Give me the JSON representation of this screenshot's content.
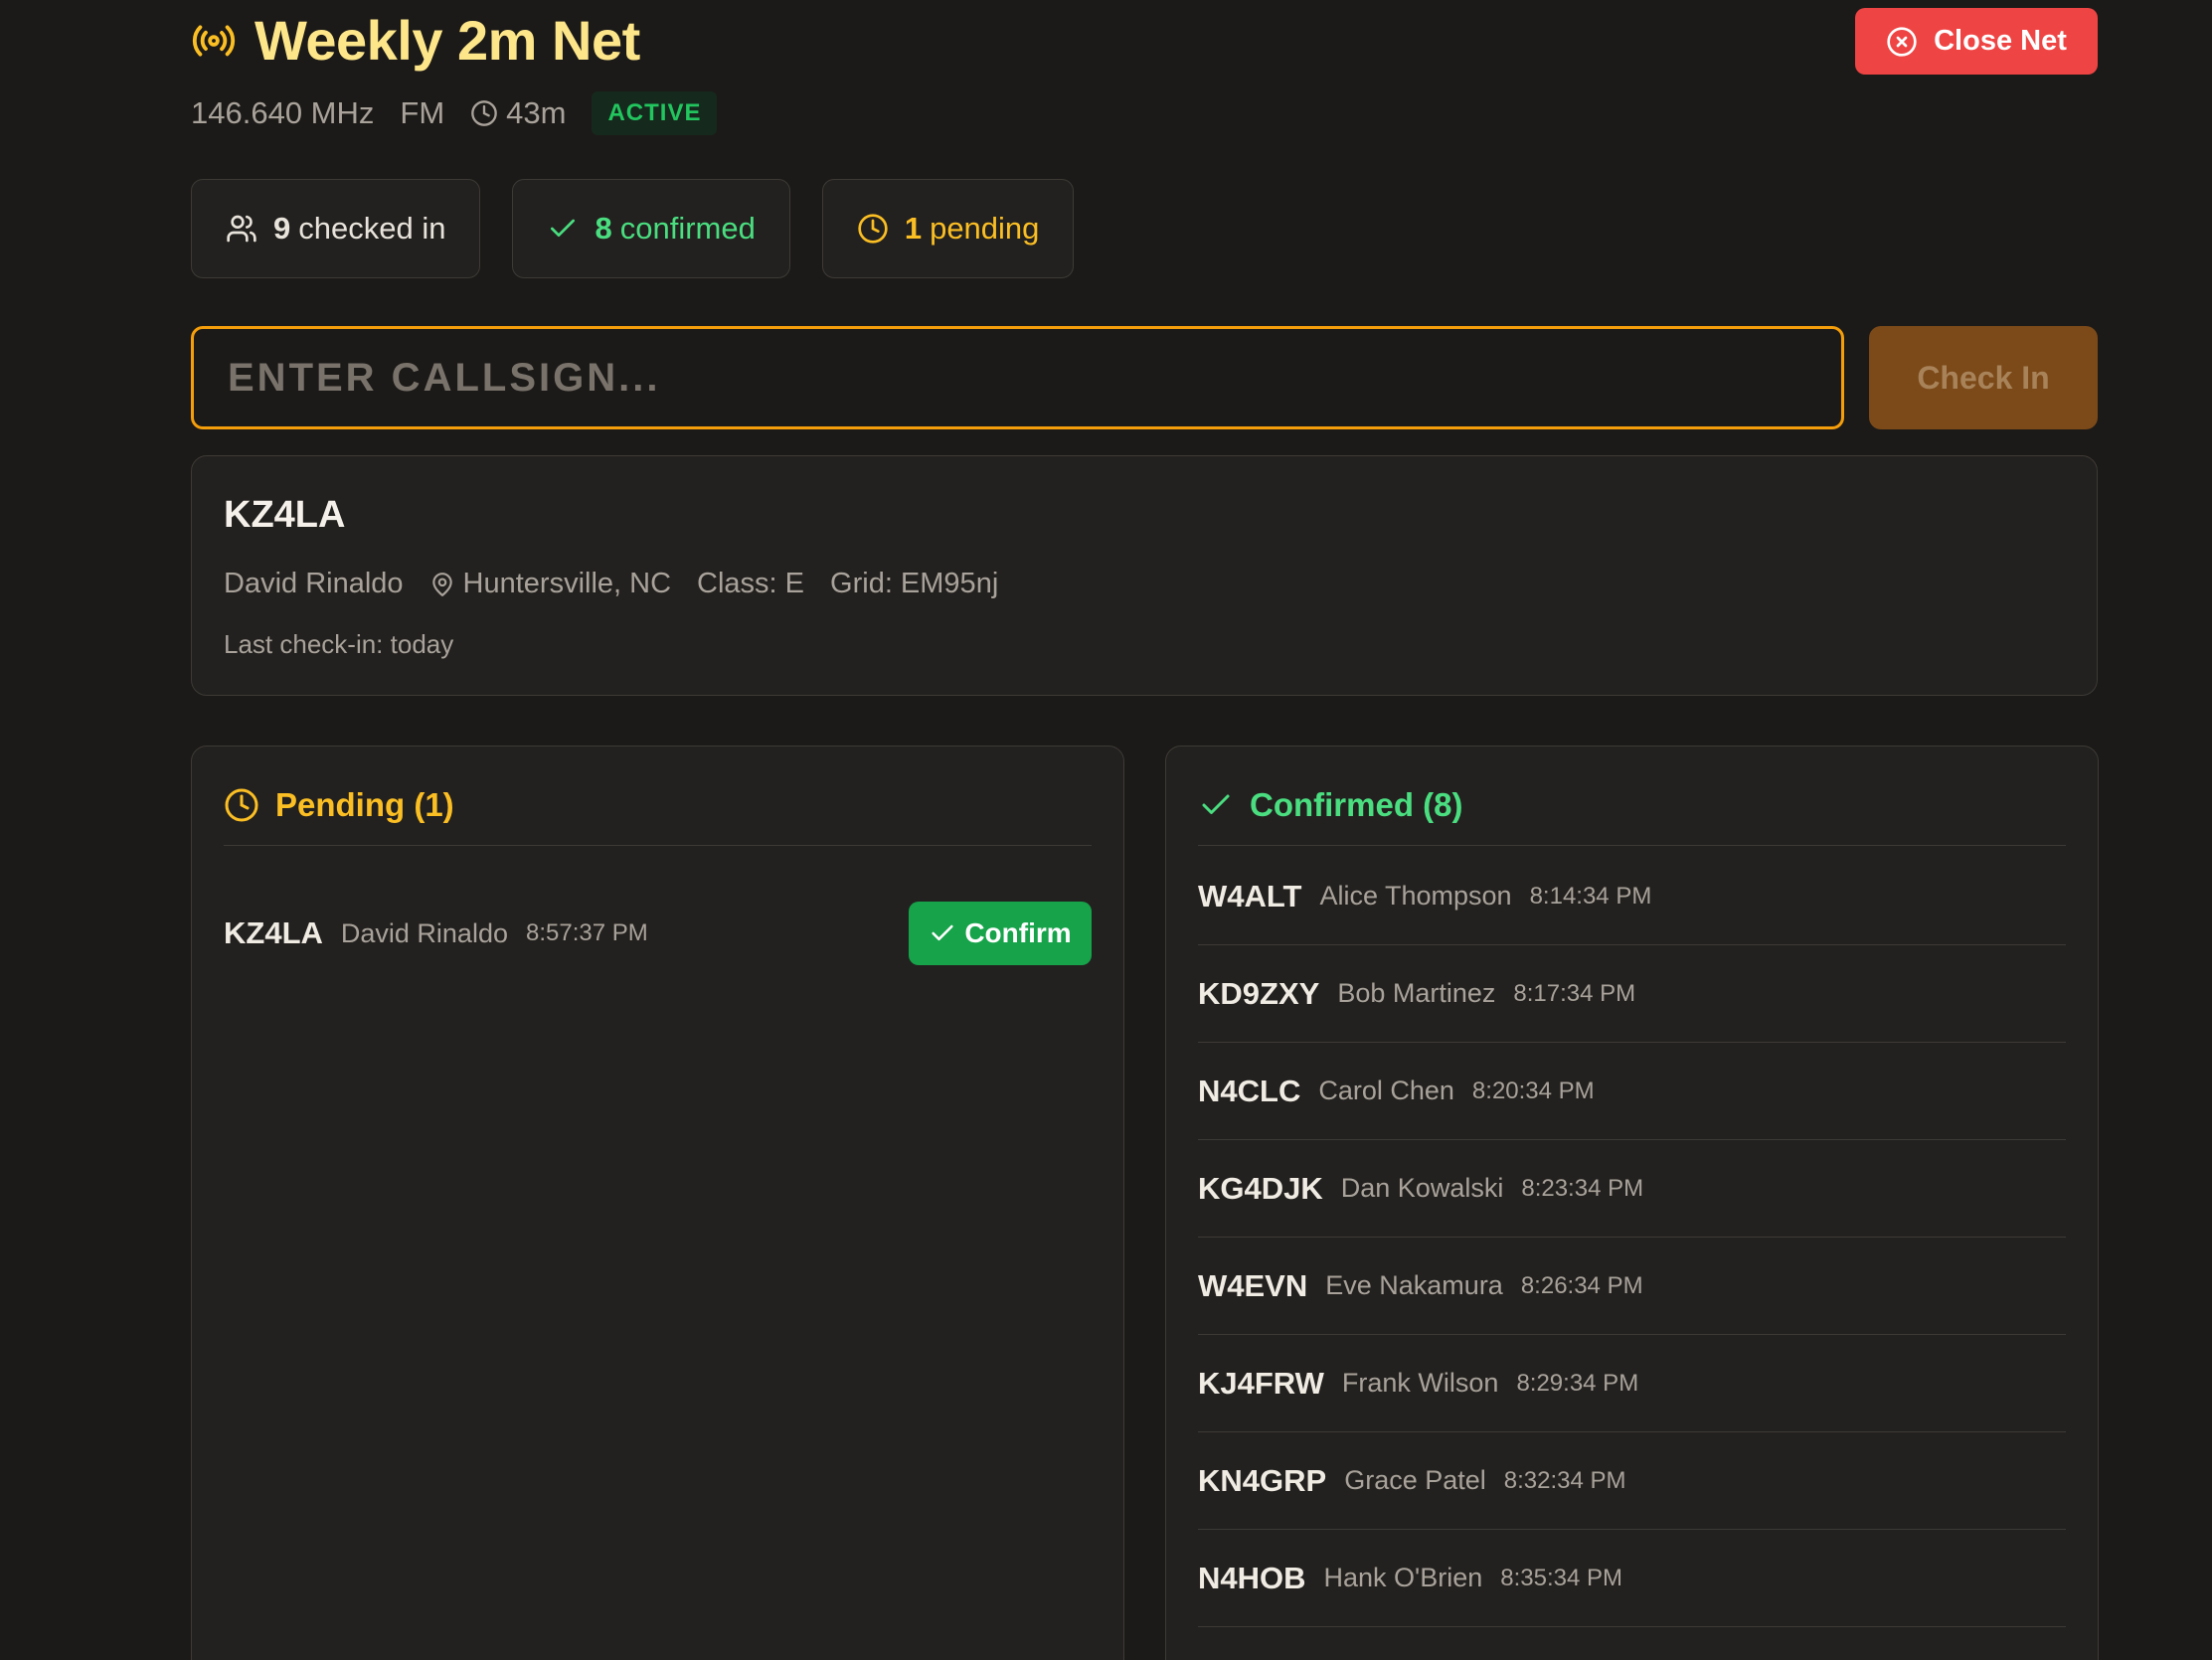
{
  "header": {
    "title": "Weekly 2m Net",
    "frequency": "146.640 MHz",
    "mode": "FM",
    "duration": "43m",
    "status": "ACTIVE",
    "close_label": "Close Net"
  },
  "stats": {
    "checked_in_count": "9",
    "checked_in_label": "checked in",
    "confirmed_count": "8",
    "confirmed_label": "confirmed",
    "pending_count": "1",
    "pending_label": "pending"
  },
  "checkin": {
    "placeholder": "ENTER CALLSIGN...",
    "value": "",
    "button_label": "Check In"
  },
  "lookup": {
    "callsign": "KZ4LA",
    "name": "David Rinaldo",
    "location": "Huntersville, NC",
    "class": "Class: E",
    "grid": "Grid: EM95nj",
    "last_checkin": "Last check-in: today"
  },
  "pending": {
    "title": "Pending (1)",
    "items": [
      {
        "callsign": "KZ4LA",
        "name": "David Rinaldo",
        "time": "8:57:37 PM",
        "action": "Confirm"
      }
    ]
  },
  "confirmed": {
    "title": "Confirmed (8)",
    "items": [
      {
        "callsign": "W4ALT",
        "name": "Alice Thompson",
        "time": "8:14:34 PM"
      },
      {
        "callsign": "KD9ZXY",
        "name": "Bob Martinez",
        "time": "8:17:34 PM"
      },
      {
        "callsign": "N4CLC",
        "name": "Carol Chen",
        "time": "8:20:34 PM"
      },
      {
        "callsign": "KG4DJK",
        "name": "Dan Kowalski",
        "time": "8:23:34 PM"
      },
      {
        "callsign": "W4EVN",
        "name": "Eve Nakamura",
        "time": "8:26:34 PM"
      },
      {
        "callsign": "KJ4FRW",
        "name": "Frank Wilson",
        "time": "8:29:34 PM"
      },
      {
        "callsign": "KN4GRP",
        "name": "Grace Patel",
        "time": "8:32:34 PM"
      },
      {
        "callsign": "N4HOB",
        "name": "Hank O'Brien",
        "time": "8:35:34 PM"
      }
    ]
  },
  "colors": {
    "accent": "#f59e0b",
    "title": "#fde68a",
    "danger": "#ef4444",
    "success": "#16a34a",
    "confirmed_text": "#4ade80",
    "pending_text": "#fbbf24"
  },
  "icons": {
    "title": "radio-broadcast-icon",
    "duration": "clock-icon",
    "close": "circle-x-icon",
    "checked_in": "users-icon",
    "confirmed": "check-icon",
    "pending": "clock-icon",
    "location": "map-pin-icon"
  }
}
